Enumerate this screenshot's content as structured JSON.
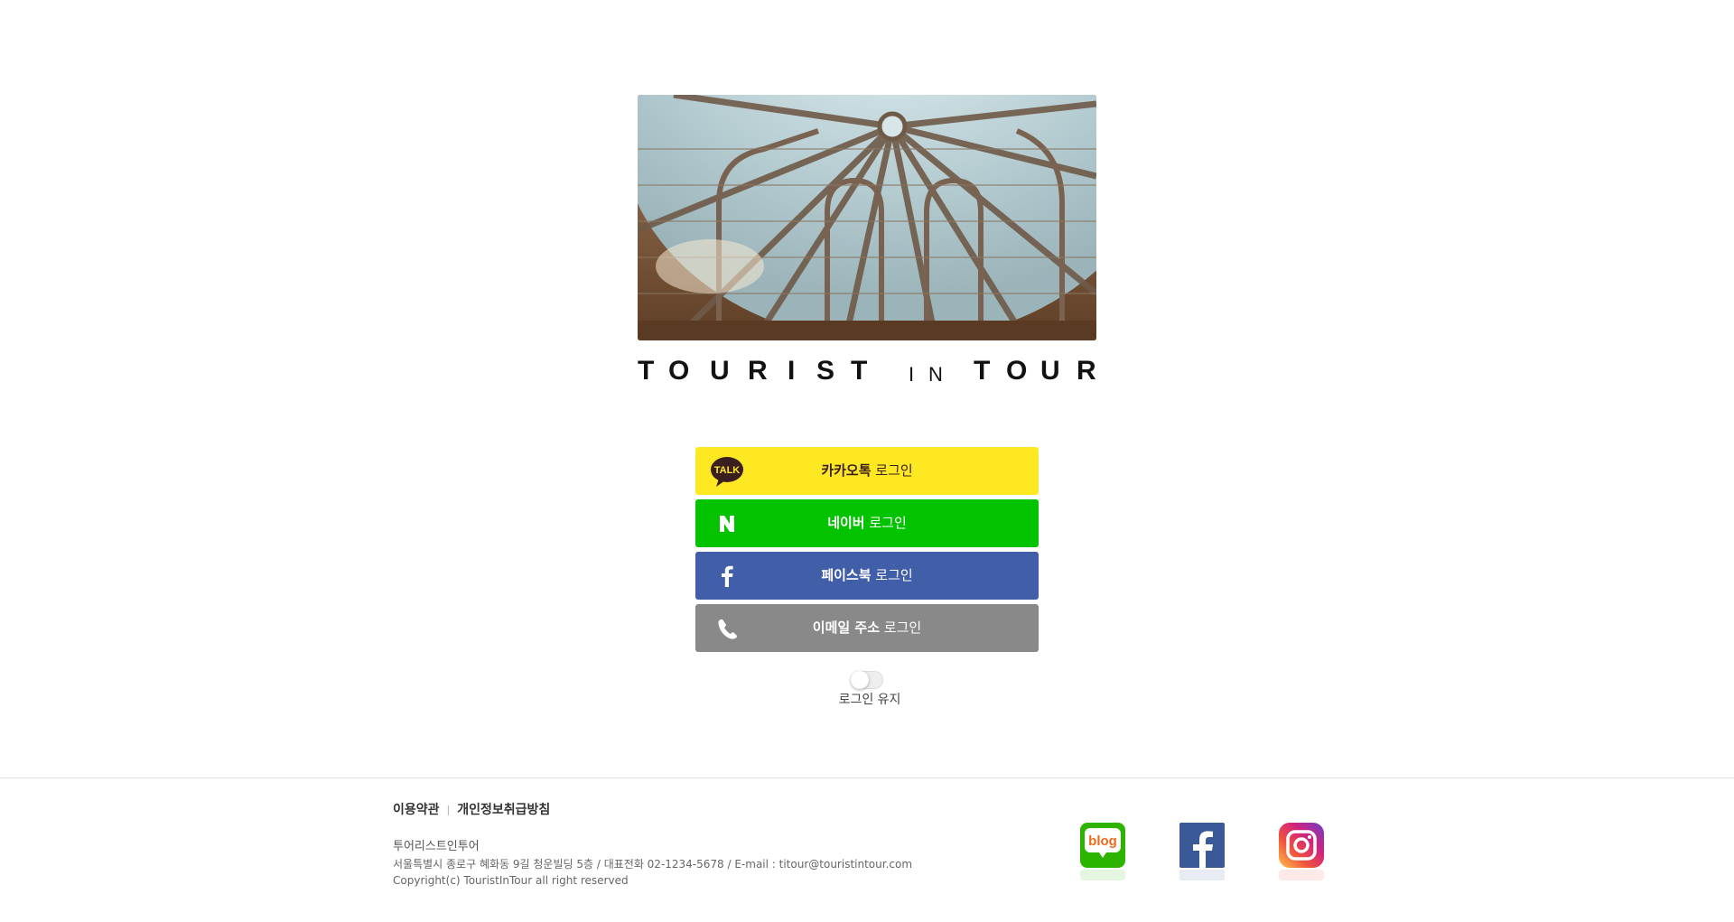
{
  "brand": {
    "word1": [
      "T",
      "O",
      "U",
      "R",
      "I",
      "S",
      "T"
    ],
    "word2": [
      "I",
      "N"
    ],
    "word3": [
      "T",
      "O",
      "U",
      "R"
    ]
  },
  "login": {
    "kakao": {
      "bold": "카카오톡",
      "rest": " 로그인",
      "icon": "kakaotalk-icon",
      "color": "#fee822"
    },
    "naver": {
      "bold": "네이버",
      "rest": " 로그인",
      "icon": "naver-icon",
      "color": "#03c200"
    },
    "facebook": {
      "bold": "페이스북",
      "rest": " 로그인",
      "icon": "facebook-icon",
      "color": "#415ea9"
    },
    "email": {
      "bold": "이메일 주소",
      "rest": " 로그인",
      "icon": "phone-icon",
      "color": "#898989"
    }
  },
  "keep_login": {
    "label": "로그인 유지",
    "checked": false
  },
  "footer": {
    "links": [
      "이용약관",
      "개인정보취급방침"
    ],
    "company": "투어리스트인투어",
    "address": "서울특별시 종로구 혜화동 9길 청운빌딩 5층 / 대표전화 02-1234-5678 / E-mail : titour@touristintour.com",
    "copyright": "Copyright(c) TouristInTour all right reserved",
    "social": {
      "blog_text": "blog",
      "icons": [
        "blog-icon",
        "facebook-icon",
        "instagram-icon"
      ]
    }
  }
}
